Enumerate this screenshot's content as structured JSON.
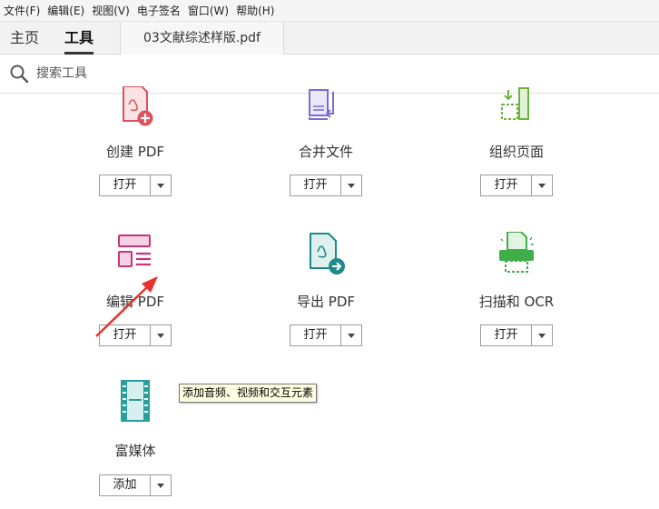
{
  "menubar": {
    "items": [
      "文件(F)",
      "编辑(E)",
      "视图(V)",
      "电子签名",
      "窗口(W)",
      "帮助(H)"
    ]
  },
  "tabs": {
    "home": "主页",
    "tools": "工具",
    "document": "03文献综述样版.pdf"
  },
  "search": {
    "placeholder": "搜索工具"
  },
  "tools": [
    {
      "label": "创建 PDF",
      "button": "打开",
      "icon": "create-pdf-icon",
      "color": "#d9535f"
    },
    {
      "label": "合并文件",
      "button": "打开",
      "icon": "combine-files-icon",
      "color": "#7b6bd1"
    },
    {
      "label": "组织页面",
      "button": "打开",
      "icon": "organize-pages-icon",
      "color": "#6db33f"
    },
    {
      "label": "编辑 PDF",
      "button": "打开",
      "icon": "edit-pdf-icon",
      "color": "#c8347a"
    },
    {
      "label": "导出 PDF",
      "button": "打开",
      "icon": "export-pdf-icon",
      "color": "#1f8a8a"
    },
    {
      "label": "扫描和 OCR",
      "button": "打开",
      "icon": "scan-ocr-icon",
      "color": "#3fae49"
    },
    {
      "label": "富媒体",
      "button": "添加",
      "icon": "rich-media-icon",
      "color": "#2a9d9d"
    }
  ],
  "tooltip": "添加音频、视频和交互元素",
  "annotation": {
    "color": "#e8322b"
  }
}
